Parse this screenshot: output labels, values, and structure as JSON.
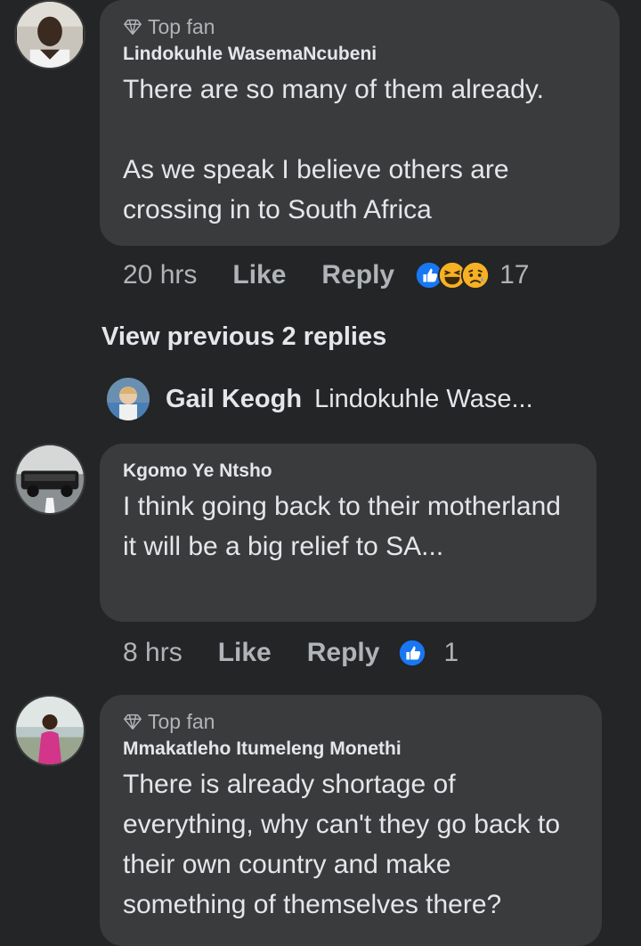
{
  "comments": [
    {
      "badge": "Top fan",
      "author": "Lindokuhle WasemaNcubeni",
      "text": "There are so many of them already.\n\nAs we speak I believe others are crossing in to South Africa",
      "time": "20 hrs",
      "like": "Like",
      "reply": "Reply",
      "reaction_count": "17",
      "reactions": [
        "like-icon",
        "haha-icon",
        "sad-icon"
      ]
    },
    {
      "author": "Kgomo Ye Ntsho",
      "text": "I think going back to their motherland it will be a big relief to SA...",
      "time": "8 hrs",
      "like": "Like",
      "reply": "Reply",
      "reaction_count": "1",
      "reactions": [
        "like-icon"
      ]
    },
    {
      "badge": "Top fan",
      "author": "Mmakatleho Itumeleng Monethi",
      "text": "There is already shortage of everything, why can't they go back to their own country and make something of themselves there?"
    }
  ],
  "view_previous": "View previous 2 replies",
  "reply_preview": {
    "author": "Gail Keogh",
    "text": "Lindokuhle Wase..."
  },
  "colors": {
    "background": "#242526",
    "bubble": "#3a3b3c",
    "text": "#e4e6eb",
    "secondary": "#b0b3b8",
    "like_blue": "#1877f2",
    "reaction_yellow": "#f7b125"
  }
}
